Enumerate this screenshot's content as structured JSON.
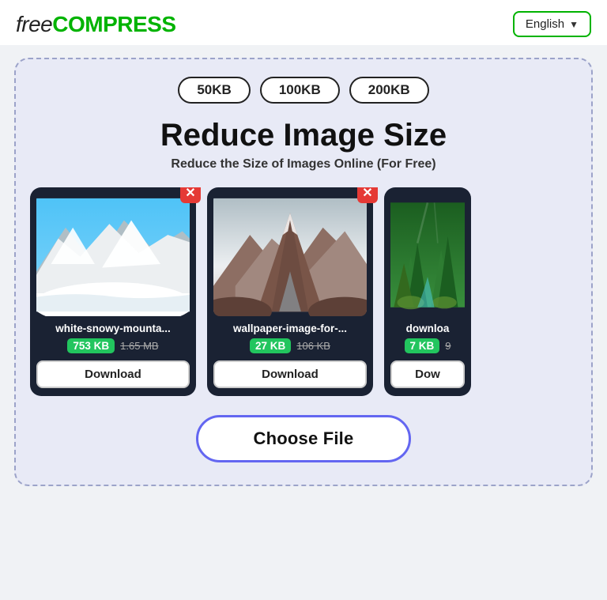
{
  "header": {
    "logo_free": "free",
    "logo_compress": "COMPRESS",
    "lang_button_label": "English",
    "lang_chevron": "▼"
  },
  "size_pills": [
    "50KB",
    "100KB",
    "200KB"
  ],
  "main": {
    "title": "Reduce Image Size",
    "subtitle": "Reduce the Size of Images Online (For Free)"
  },
  "cards": [
    {
      "filename": "white-snowy-mounta...",
      "size_new": "753 KB",
      "size_old": "1.65 MB",
      "download_label": "Download",
      "type": "snow"
    },
    {
      "filename": "wallpaper-image-for-...",
      "size_new": "27 KB",
      "size_old": "106 KB",
      "download_label": "Download",
      "type": "brown"
    },
    {
      "filename": "downloa",
      "size_new": "7 KB",
      "size_old": "9",
      "download_label": "Dow",
      "type": "forest"
    }
  ],
  "choose_file_label": "Choose File"
}
